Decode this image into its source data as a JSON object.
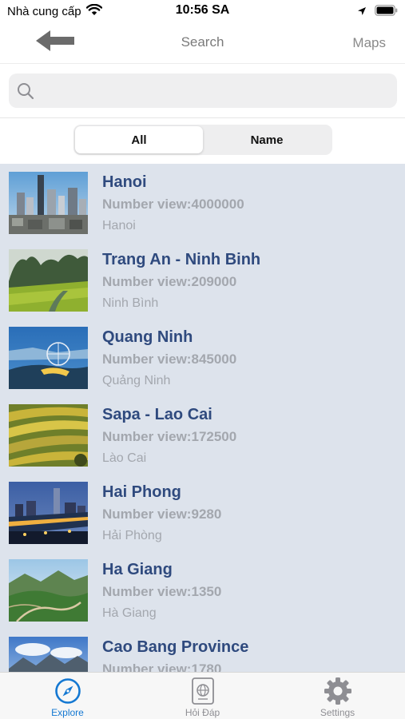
{
  "status_bar": {
    "carrier": "Nhà cung cấp",
    "time": "10:56 SA"
  },
  "nav": {
    "back_icon": "back-arrow-icon",
    "title": "Search",
    "right_label": "Maps"
  },
  "search": {
    "placeholder": "",
    "value": ""
  },
  "segments": [
    {
      "label": "All",
      "active": true
    },
    {
      "label": "Name",
      "active": false
    }
  ],
  "places": [
    {
      "title": "Hanoi",
      "views_label": "Number view:",
      "views": "4000000",
      "subtitle": "Hanoi",
      "thumb": "city-skyline"
    },
    {
      "title": "Trang An - Ninh Binh",
      "views_label": "Number view:",
      "views": "209000",
      "subtitle": "Ninh Bình",
      "thumb": "rice-field-karst"
    },
    {
      "title": "Quang Ninh",
      "views_label": "Number view:",
      "views": "845000",
      "subtitle": "Quảng Ninh",
      "thumb": "bay-ferris-wheel"
    },
    {
      "title": "Sapa - Lao Cai",
      "views_label": "Number view:",
      "views": "172500",
      "subtitle": "Lào Cai",
      "thumb": "rice-terraces"
    },
    {
      "title": "Hai Phong",
      "views_label": "Number view:",
      "views": "9280",
      "subtitle": "Hải Phòng",
      "thumb": "night-city-river"
    },
    {
      "title": "Ha Giang",
      "views_label": "Number view:",
      "views": "1350",
      "subtitle": "Hà Giang",
      "thumb": "mountain-road"
    },
    {
      "title": "Cao Bang Province",
      "views_label": "Number view:",
      "views": "1780",
      "subtitle": "",
      "thumb": "sky-mountains"
    }
  ],
  "tabs": [
    {
      "label": "Explore",
      "icon": "compass-icon",
      "active": true
    },
    {
      "label": "Hỏi Đáp",
      "icon": "passport-globe-icon",
      "active": false
    },
    {
      "label": "Settings",
      "icon": "gear-icon",
      "active": false
    }
  ],
  "colors": {
    "accent": "#1478d2",
    "title_blue": "#2f4a7e",
    "list_bg": "#dde3ec",
    "muted_text": "#a3a7ae"
  }
}
